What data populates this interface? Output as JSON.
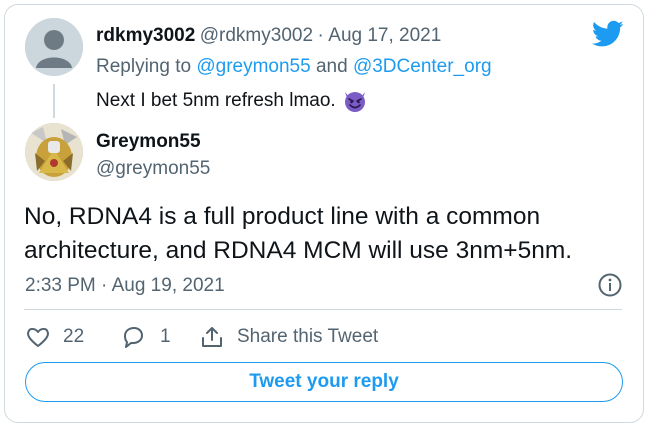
{
  "reply_tweet": {
    "display_name": "rdkmy3002",
    "handle": "@rdkmy3002",
    "separator": "·",
    "date": "Aug 17, 2021",
    "replying_prefix": "Replying to",
    "replying_users": [
      "@greymon55",
      "@3DCenter_org"
    ],
    "replying_joiner": "and",
    "text": "Next I bet 5nm refresh lmao.",
    "emoji": "smiling-face-with-horns"
  },
  "main_tweet": {
    "display_name": "Greymon55",
    "handle": "@greymon55",
    "text": "No, RDNA4 is a full product line with a common architecture, and RDNA4 MCM will use 3nm+5nm.",
    "timestamp": "2:33 PM · Aug 19, 2021",
    "info_icon": "info-icon"
  },
  "actions": {
    "like_count": "22",
    "reply_count": "1",
    "share_label": "Share this Tweet"
  },
  "reply_button_label": "Tweet your reply",
  "colors": {
    "accent": "#1d9bf0",
    "text": "#0f1419",
    "muted": "#536471",
    "border": "#cfd9de",
    "emoji": "#7b5cc7"
  }
}
